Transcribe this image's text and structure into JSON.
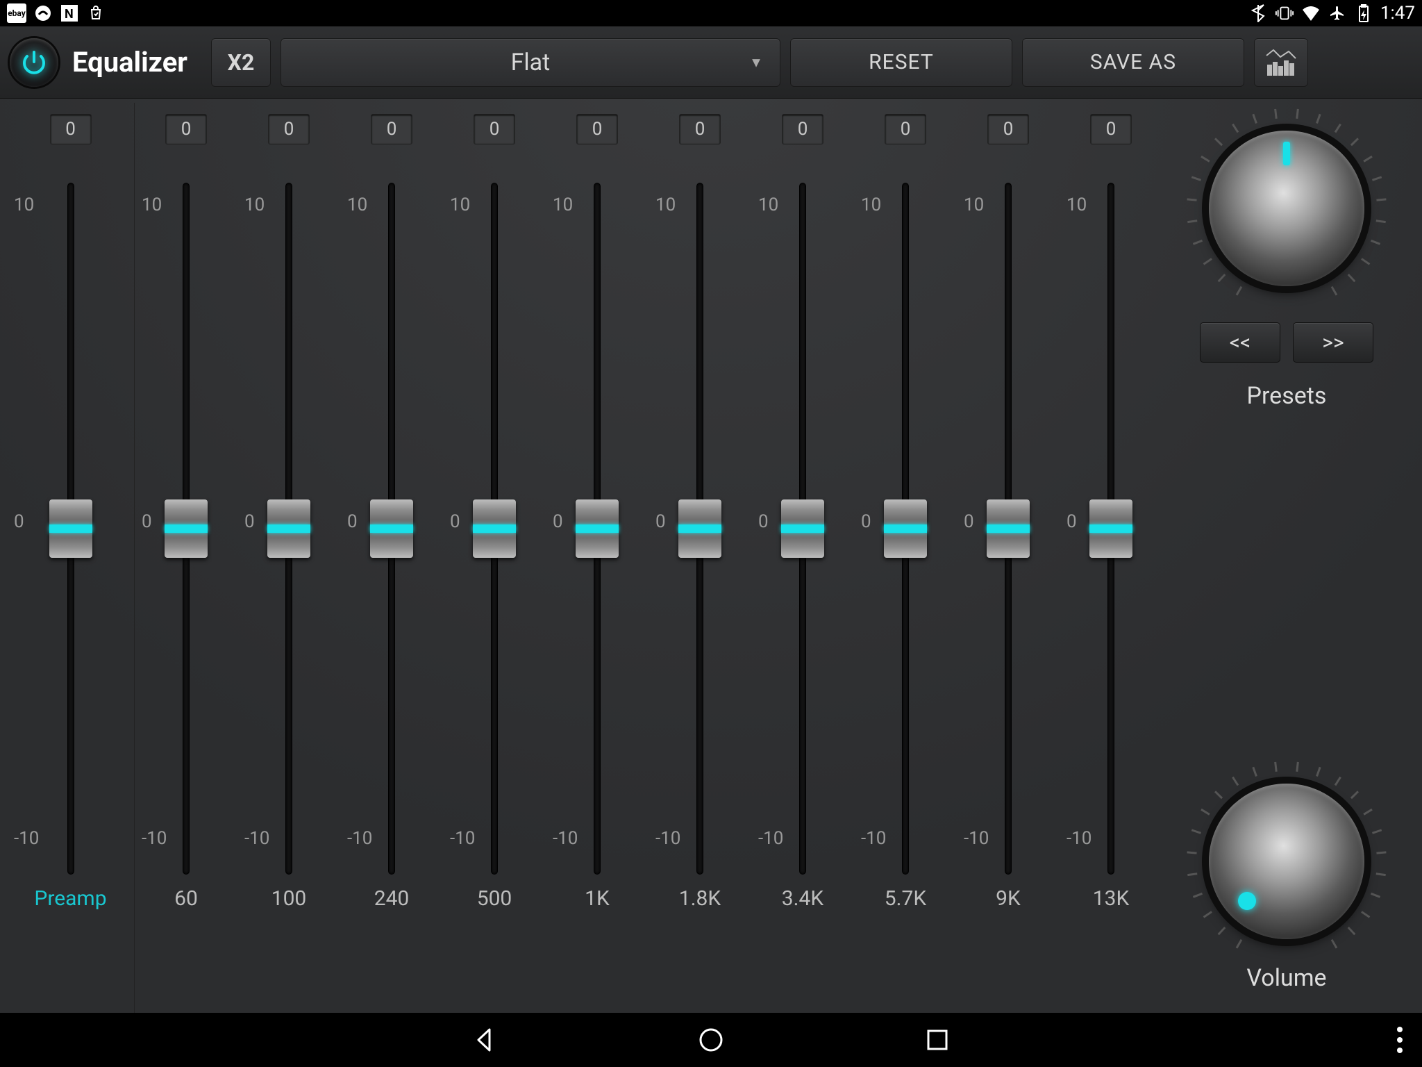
{
  "status": {
    "time": "1:47"
  },
  "toolbar": {
    "title": "Equalizer",
    "x2_label": "X2",
    "preset_selected": "Flat",
    "reset_label": "RESET",
    "saveas_label": "SAVE AS"
  },
  "scale": {
    "max": "10",
    "mid": "0",
    "min": "-10"
  },
  "preamp": {
    "value": "0",
    "label": "Preamp"
  },
  "bands": [
    {
      "value": "0",
      "freq": "60"
    },
    {
      "value": "0",
      "freq": "100"
    },
    {
      "value": "0",
      "freq": "240"
    },
    {
      "value": "0",
      "freq": "500"
    },
    {
      "value": "0",
      "freq": "1K"
    },
    {
      "value": "0",
      "freq": "1.8K"
    },
    {
      "value": "0",
      "freq": "3.4K"
    },
    {
      "value": "0",
      "freq": "5.7K"
    },
    {
      "value": "0",
      "freq": "9K"
    },
    {
      "value": "0",
      "freq": "13K"
    }
  ],
  "side": {
    "prev": "<<",
    "next": ">>",
    "presets_label": "Presets",
    "volume_label": "Volume"
  }
}
